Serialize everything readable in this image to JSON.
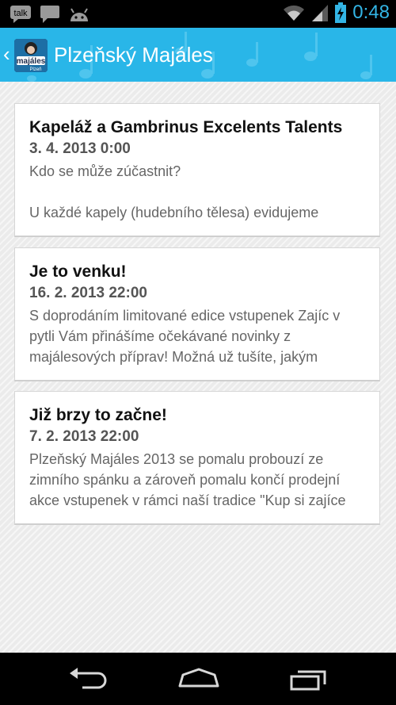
{
  "status_bar": {
    "time": "0:48",
    "talk_label": "talk",
    "icons": [
      "talk-icon",
      "chat-icon",
      "android-icon",
      "wifi-icon",
      "signal-icon",
      "battery-charging-icon"
    ]
  },
  "action_bar": {
    "title": "Plzeňský Majáles",
    "logo_text": "majáles",
    "logo_subtext": "Plzeň",
    "color": "#29b6e8"
  },
  "cards": [
    {
      "title": "Kapeláž a Gambrinus Excelents Talents",
      "date": "3. 4. 2013 0:00",
      "lines": [
        "Kdo se může zúčastnit?",
        "",
        "U každé kapely (hudebního tělesa) evidujeme"
      ]
    },
    {
      "title": "Je to venku!",
      "date": "16. 2. 2013 22:00",
      "lines": [
        "S doprodáním limitované edice vstupenek Zajíc v",
        "pytli Vám přinášíme očekávané novinky z",
        "majálesových příprav! Možná už tušíte, jakým"
      ]
    },
    {
      "title": "Již brzy to začne!",
      "date": "7. 2. 2013 22:00",
      "lines": [
        "Plzeňský Majáles 2013 se pomalu probouzí ze",
        "zimního spánku a zároveň pomalu končí prodejní",
        "akce vstupenek v rámci naší tradice \"Kup si zajíce"
      ]
    }
  ],
  "nav_bar": {
    "buttons": [
      "back-icon",
      "home-icon",
      "recent-apps-icon"
    ]
  }
}
